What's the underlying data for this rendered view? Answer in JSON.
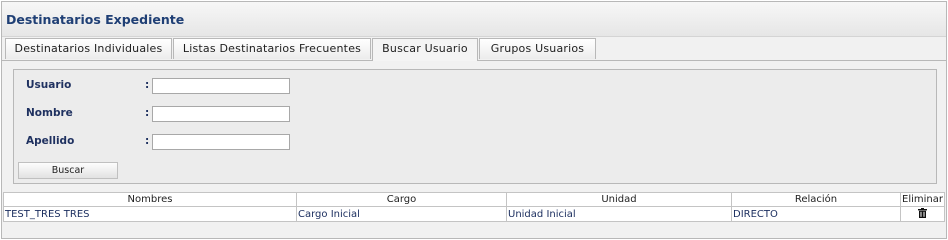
{
  "window": {
    "title": "Destinatarios Expediente"
  },
  "tabs": [
    {
      "label": "Destinatarios Individuales"
    },
    {
      "label": "Listas Destinatarios Frecuentes"
    },
    {
      "label": "Buscar Usuario"
    },
    {
      "label": "Grupos Usuarios"
    }
  ],
  "active_tab": "Buscar Usuario",
  "search_form": {
    "fields": [
      {
        "label": "Usuario",
        "separator": ":",
        "value": ""
      },
      {
        "label": "Nombre",
        "separator": ":",
        "value": ""
      },
      {
        "label": "Apellido",
        "separator": ":",
        "value": ""
      }
    ],
    "button_label": "Buscar"
  },
  "results_table": {
    "columns": [
      "Nombres",
      "Cargo",
      "Unidad",
      "Relación",
      "Eliminar"
    ],
    "rows": [
      {
        "nombres": "TEST_TRES TRES",
        "cargo": "Cargo Inicial",
        "unidad": "Unidad Inicial",
        "relacion": "DIRECTO",
        "eliminar_icon": "trash-icon"
      }
    ]
  },
  "colors": {
    "title_text": "#1f3f75",
    "label_text": "#1f3160",
    "border": "#b8b8b8"
  }
}
